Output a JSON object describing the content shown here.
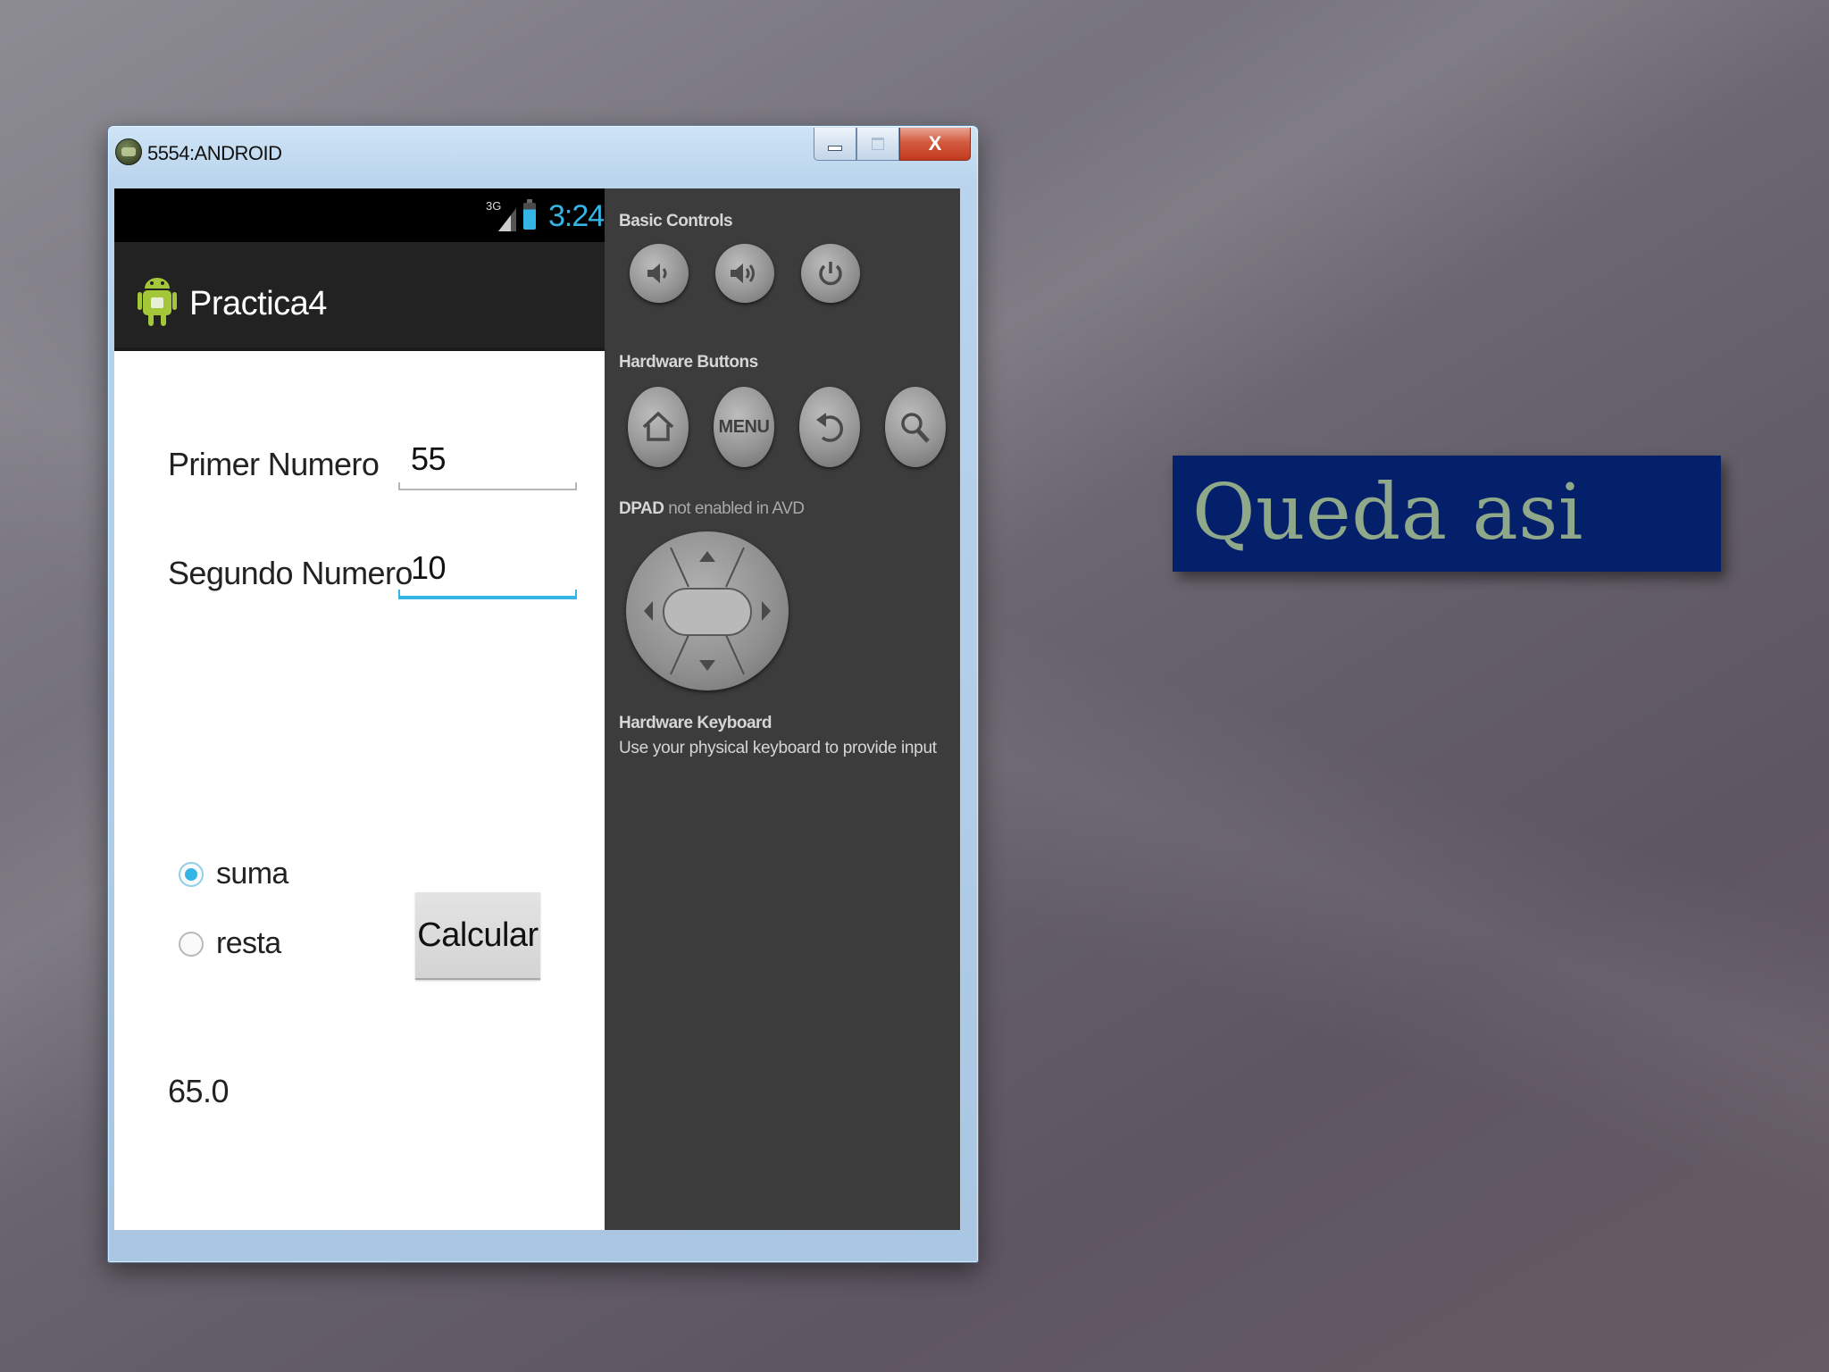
{
  "window": {
    "title": "5554:ANDROID",
    "close_label": "X"
  },
  "status_bar": {
    "network": "3G",
    "time": "3:24"
  },
  "app": {
    "title": "Practica4"
  },
  "form": {
    "primer_label": "Primer Numero",
    "primer_value": "55",
    "segundo_label": "Segundo Numero",
    "segundo_value": "10",
    "radio_suma": "suma",
    "radio_resta": "resta",
    "selected": "suma",
    "calcular": "Calcular",
    "result": "65.0"
  },
  "controls": {
    "basic_title": "Basic Controls",
    "hardware_title": "Hardware Buttons",
    "menu_label": "MENU",
    "dpad_title_bold": "DPAD",
    "dpad_title_rest": "not enabled in AVD",
    "keyboard_title": "Hardware Keyboard",
    "keyboard_desc": "Use your physical keyboard to provide input"
  },
  "slide": {
    "title": "Queda asi"
  },
  "colors": {
    "accent": "#33b5e5",
    "title_box": "#05206a",
    "title_text": "#90a88a",
    "panel": "#3c3c3c"
  },
  "icons": {
    "volume_down": "volume-down-icon",
    "volume_up": "volume-up-icon",
    "power": "power-icon",
    "home": "home-icon",
    "back": "back-icon",
    "search": "search-icon"
  }
}
